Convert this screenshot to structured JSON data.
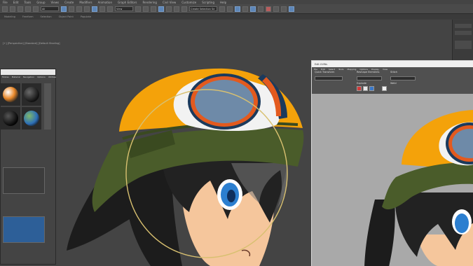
{
  "menubar": {
    "items": [
      "File",
      "Edit",
      "Tools",
      "Group",
      "Views",
      "Create",
      "Modifiers",
      "Animation",
      "Graph Editors",
      "Rendering",
      "Civil View",
      "Customize",
      "Scripting",
      "Help"
    ]
  },
  "toolbar": {
    "selection_filter": "All",
    "view_mode": "View",
    "selection_set": "Create Selection Se"
  },
  "tabs": [
    "Modeling",
    "Freeform",
    "Selection",
    "Object Paint",
    "Populate"
  ],
  "viewport": {
    "label": "[+] [Perspective] [Standard] [Default Shading]"
  },
  "material_editor": {
    "menu": [
      "Modes",
      "Material",
      "Navigation",
      "Options",
      "Utilities"
    ]
  },
  "skin_window": {
    "title": "Edit UVWs",
    "menu": [
      "File",
      "Edit",
      "Select",
      "Tools",
      "Mapping",
      "Options",
      "Display",
      "View"
    ],
    "labels": {
      "quick_transform": "Quick Transform",
      "reshape": "Reshape Elements",
      "stitch": "Stitch",
      "explode": "Explode",
      "weld": "Weld"
    },
    "swatch_colors": [
      "#d23a3a",
      "#e8e8e8",
      "#3a78c8",
      "#f0f0f0"
    ]
  },
  "colors": {
    "helmet_orange": "#f4a20a",
    "band_green": "#4a5c2a",
    "goggle_lens": "#6e8aa8",
    "goggle_rim": "#e35a1e",
    "hair_black": "#1c1c1c",
    "skin_tone": "#f5c69c",
    "eye_blue": "#2c7fd0",
    "selection_circle": "#d8c070"
  }
}
